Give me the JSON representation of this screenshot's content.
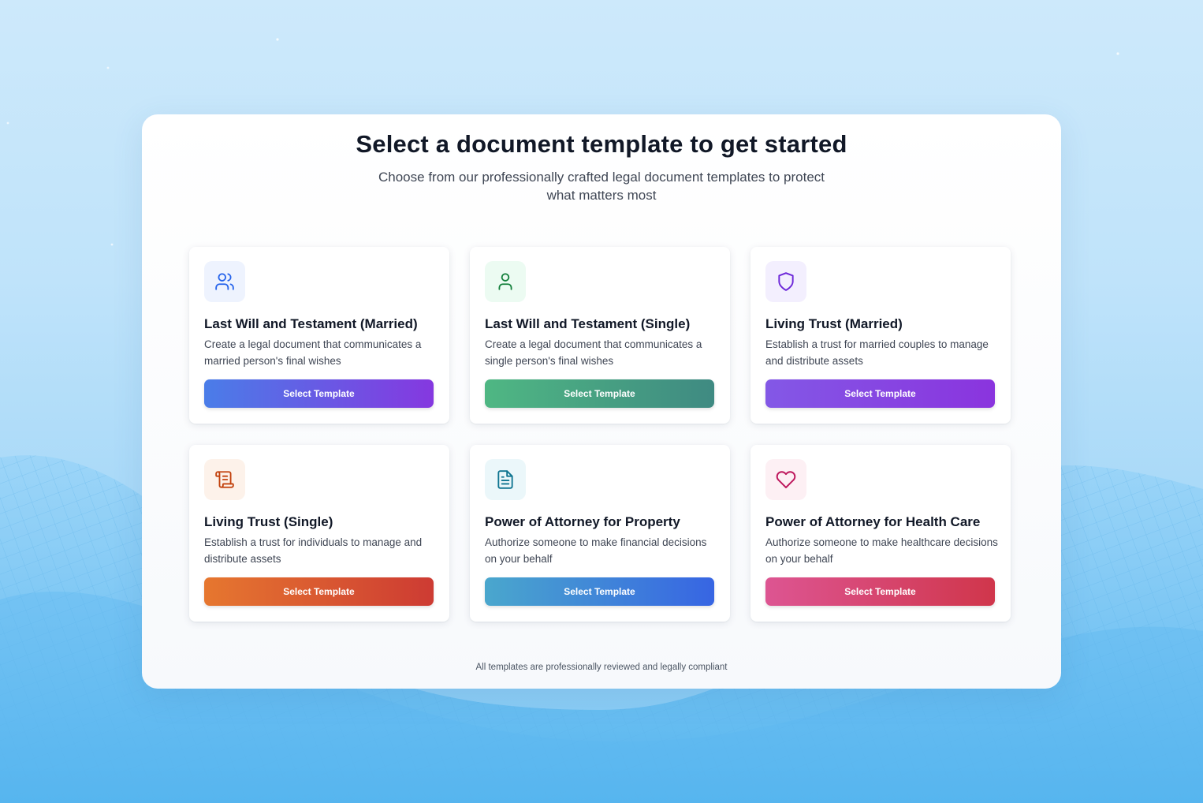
{
  "page": {
    "title": "Select a document template to get started",
    "subtitle": "Choose from our professionally crafted legal document templates to protect what matters most",
    "footer_note": "All templates are professionally reviewed and legally compliant"
  },
  "templates": [
    {
      "title": "Last Will and Testament (Married)",
      "description": "Create a legal document that communicates a married person's final wishes",
      "button_label": "Select Template",
      "icon": "users-icon",
      "icon_color": "#2563eb",
      "icon_bg": "#eef3fe",
      "button_gradient": [
        "#4a7de8",
        "#8538e0"
      ]
    },
    {
      "title": "Last Will and Testament (Single)",
      "description": "Create a legal document that communicates a single person's final wishes",
      "button_label": "Select Template",
      "icon": "user-icon",
      "icon_color": "#15803d",
      "icon_bg": "#ecfbf2",
      "button_gradient": [
        "#4fb783",
        "#3f8a82"
      ]
    },
    {
      "title": "Living Trust (Married)",
      "description": "Establish a trust for married couples to manage and distribute assets",
      "button_label": "Select Template",
      "icon": "shield-icon",
      "icon_color": "#6d28d9",
      "icon_bg": "#f3effe",
      "button_gradient": [
        "#8358e6",
        "#8a34de"
      ]
    },
    {
      "title": "Living Trust (Single)",
      "description": "Establish a trust for individuals to manage and distribute assets",
      "button_label": "Select Template",
      "icon": "scroll-icon",
      "icon_color": "#c2410c",
      "icon_bg": "#fdf2ea",
      "button_gradient": [
        "#e6772f",
        "#cd3b33"
      ]
    },
    {
      "title": "Power of Attorney for Property",
      "description": "Authorize someone to make financial decisions on your behalf",
      "button_label": "Select Template",
      "icon": "file-text-icon",
      "icon_color": "#0e7490",
      "icon_bg": "#ebf7fa",
      "button_gradient": [
        "#4aa7cd",
        "#3765e3"
      ]
    },
    {
      "title": "Power of Attorney for Health Care",
      "description": "Authorize someone to make healthcare decisions on your behalf",
      "button_label": "Select Template",
      "icon": "heart-icon",
      "icon_color": "#be185d",
      "icon_bg": "#fdf0f4",
      "button_gradient": [
        "#dd5592",
        "#d0364b"
      ]
    }
  ]
}
